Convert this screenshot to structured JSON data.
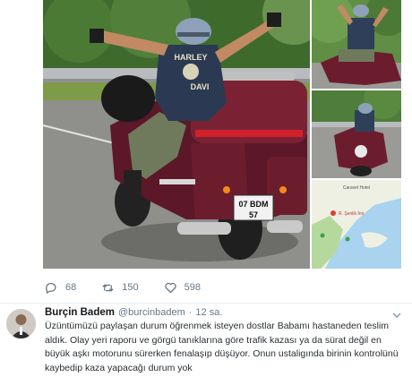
{
  "tweet_media": {
    "main_plate": {
      "line1": "07 BDM",
      "line2": "57"
    },
    "vest_text": {
      "top": "HARLEY",
      "bottom": "DAVI"
    },
    "map_label": {
      "top": "Caravel Hotel",
      "hotel": "R. Şenlik İnn"
    }
  },
  "actions": {
    "replies": "68",
    "retweets": "150",
    "likes": "598"
  },
  "tweet2": {
    "name": "Burçin Badem",
    "handle": "@burcinbadem",
    "sep": "·",
    "time": "12 sa.",
    "text": "Üzüntümüzü paylaşan durum öğrenmek isteyen dostlar Babamı hastaneden teslim aldık. Olay yeri raporu ve görgü tanıklarına göre trafik kazası ya da sürat değil en büyük aşkı motorunu sürerken fenalaşıp düşüyor. Onun ustaligında birinin kontrolünü kaybedip kaza yapacağı durum yok"
  },
  "colors": {
    "accent": "#1da1f2",
    "muted": "#657786",
    "motorcycle": "#6b1d2e"
  }
}
